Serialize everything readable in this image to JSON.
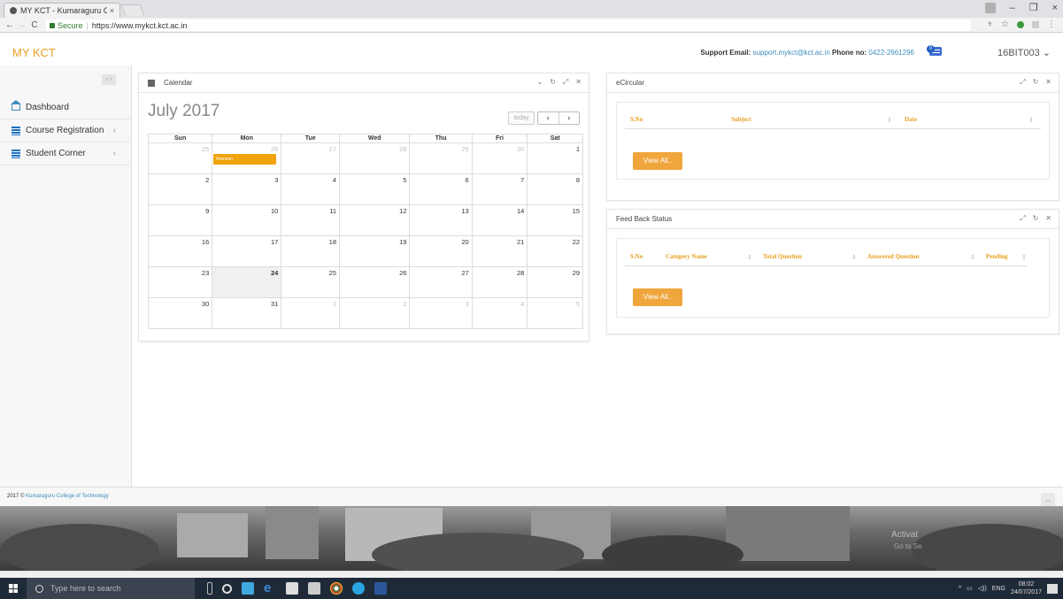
{
  "browser": {
    "tab_title": "MY KCT - Kumaraguru C",
    "tab_close": "×",
    "secure_label": "Secure",
    "url": "https://www.mykct.kct.ac.in",
    "window_controls": {
      "minimize": "–",
      "maximize": "❐",
      "close": "×"
    }
  },
  "header": {
    "brand": "MY KCT",
    "support_email_label": "Support Email:",
    "support_email": "support.mykct@kct.ac.in",
    "phone_label": "Phone no:",
    "phone": "0422-2661296",
    "message_count": "0",
    "user": "16BIT003",
    "user_caret": "⌄"
  },
  "sidebar": {
    "toggle": "‹ ›",
    "items": [
      {
        "label": "Dashboard",
        "icon": "home-icon"
      },
      {
        "label": "Course Registration",
        "icon": "list-icon",
        "chevron": "‹"
      },
      {
        "label": "Student Corner",
        "icon": "list-icon",
        "chevron": "‹"
      }
    ]
  },
  "calendar": {
    "panel_title": "Calendar",
    "month_title": "July 2017",
    "today_label": "today",
    "prev": "‹",
    "next": "›",
    "weekdays": [
      "Sun",
      "Mon",
      "Tue",
      "Wed",
      "Thu",
      "Fri",
      "Sat"
    ],
    "weeks": [
      [
        "25",
        "26",
        "27",
        "28",
        "29",
        "30",
        "1"
      ],
      [
        "2",
        "3",
        "4",
        "5",
        "6",
        "7",
        "8"
      ],
      [
        "9",
        "10",
        "11",
        "12",
        "13",
        "14",
        "15"
      ],
      [
        "16",
        "17",
        "18",
        "19",
        "20",
        "21",
        "22"
      ],
      [
        "23",
        "24",
        "25",
        "26",
        "27",
        "28",
        "29"
      ],
      [
        "30",
        "31",
        "1",
        "2",
        "3",
        "4",
        "5"
      ]
    ],
    "event_label": "Ramzan",
    "event_color": "#f0a30a"
  },
  "ecircular": {
    "panel_title": "eCircular",
    "columns": [
      "S.No",
      "Subject",
      "Date"
    ],
    "view_all": "View All.."
  },
  "feedback": {
    "panel_title": "Feed Back Status",
    "columns": [
      "S.No",
      "Category Name",
      "Total Question",
      "Answered Question",
      "Pending"
    ],
    "view_all": "View All.."
  },
  "footer": {
    "year": "2017 ©",
    "org": "Kumaraguru College of Technology"
  },
  "watermark": {
    "line1": "Activat",
    "line2": "Go to Se"
  },
  "taskbar": {
    "search_placeholder": "Type here to search",
    "lang": "ENG",
    "time": "08:02",
    "date": "24/07/2017"
  },
  "colors": {
    "brand_orange": "#e8a020",
    "link_blue": "#3c8dbc",
    "button_orange": "#f0a63c"
  }
}
